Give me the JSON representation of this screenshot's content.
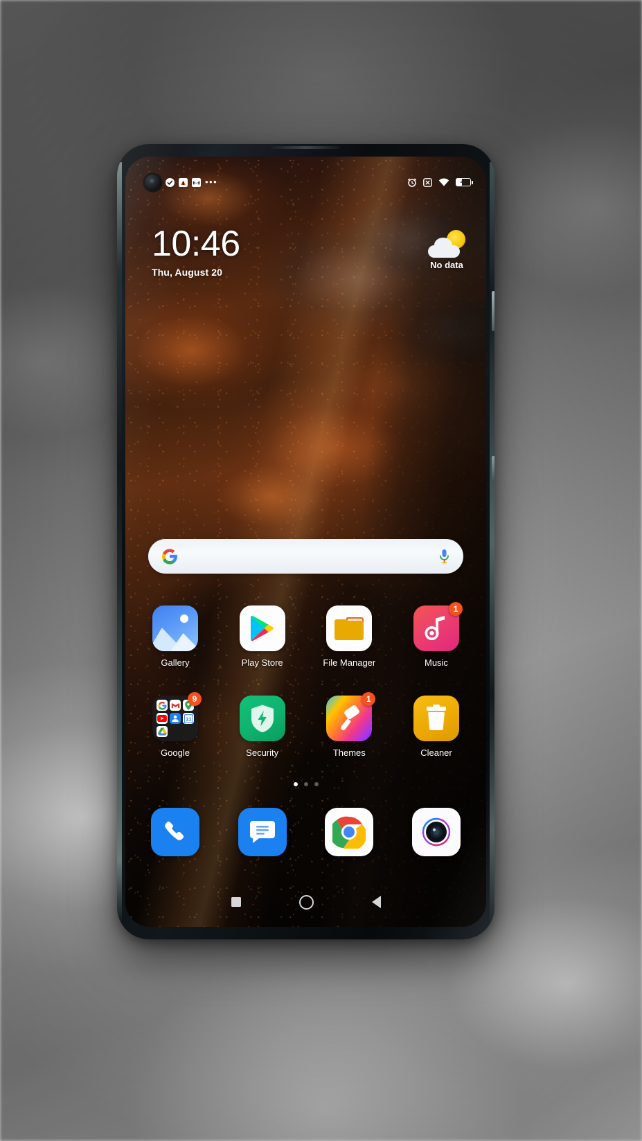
{
  "device": {
    "name": "android-smartphone",
    "os_skin": "MIUI"
  },
  "status_bar": {
    "left_icons": [
      {
        "name": "check-circle-icon",
        "glyph": "✔"
      },
      {
        "name": "app-notification-icon",
        "glyph": "↑"
      },
      {
        "name": "gmail-icon",
        "glyph": "M"
      },
      {
        "name": "more-notifications-icon",
        "glyph": "•••"
      }
    ],
    "right_icons": [
      {
        "name": "alarm-icon",
        "glyph": "⏰"
      },
      {
        "name": "silent-mode-icon",
        "glyph": "✕"
      },
      {
        "name": "wifi-icon",
        "glyph": "wifi"
      }
    ],
    "battery": {
      "label": "41",
      "percent": 41
    }
  },
  "clock_widget": {
    "time": "10:46",
    "date": "Thu, August 20"
  },
  "weather_widget": {
    "icon": "partly-cloudy-icon",
    "text": "No data",
    "sun_color": "#f6c400",
    "cloud_color": "#eef2f7"
  },
  "search": {
    "provider": "Google",
    "placeholder": "",
    "value": "",
    "left_icon": "google-g-icon",
    "right_icon": "microphone-icon"
  },
  "app_rows": [
    {
      "row": 1,
      "apps": [
        {
          "name": "gallery",
          "label": "Gallery",
          "icon": "gallery-icon",
          "badge": null
        },
        {
          "name": "play-store",
          "label": "Play Store",
          "icon": "play-store-icon",
          "badge": null
        },
        {
          "name": "file-manager",
          "label": "File Manager",
          "icon": "folder-icon",
          "badge": null
        },
        {
          "name": "music",
          "label": "Music",
          "icon": "music-note-icon",
          "badge": "1"
        }
      ]
    },
    {
      "row": 2,
      "apps": [
        {
          "name": "google-folder",
          "label": "Google",
          "icon": "app-folder-icon",
          "badge": "9"
        },
        {
          "name": "security",
          "label": "Security",
          "icon": "shield-bolt-icon",
          "badge": null
        },
        {
          "name": "themes",
          "label": "Themes",
          "icon": "paint-roller-icon",
          "badge": "1"
        },
        {
          "name": "cleaner",
          "label": "Cleaner",
          "icon": "trash-icon",
          "badge": null
        }
      ]
    }
  ],
  "google_folder_contents": [
    {
      "name": "google-search",
      "glyph": "G"
    },
    {
      "name": "gmail",
      "glyph": "M"
    },
    {
      "name": "maps",
      "glyph": "▾"
    },
    {
      "name": "youtube",
      "glyph": "▶"
    },
    {
      "name": "contacts",
      "glyph": "●"
    },
    {
      "name": "calendar",
      "glyph": "21"
    },
    {
      "name": "drive",
      "glyph": "▲"
    }
  ],
  "page_indicator": {
    "total": 3,
    "active": 1
  },
  "dock": [
    {
      "name": "phone",
      "icon": "phone-icon",
      "color": "#1b81f1"
    },
    {
      "name": "messages",
      "icon": "message-bubble-icon",
      "color": "#1b81f1"
    },
    {
      "name": "chrome",
      "icon": "chrome-icon",
      "color": "#ffffff"
    },
    {
      "name": "camera",
      "icon": "camera-lens-icon",
      "color": "#ffffff"
    }
  ],
  "nav_bar": [
    {
      "name": "recents-button",
      "icon": "square-icon"
    },
    {
      "name": "home-button",
      "icon": "circle-icon"
    },
    {
      "name": "back-button",
      "icon": "triangle-left-icon"
    }
  ],
  "colors": {
    "accent_blue": "#1b81f1",
    "badge_orange": "#f4511e",
    "security_green": "#12c07a",
    "cleaner_yellow": "#f6bd14",
    "folder_yellow": "#e8a900",
    "wallpaper_rust": "#7a3a16"
  }
}
